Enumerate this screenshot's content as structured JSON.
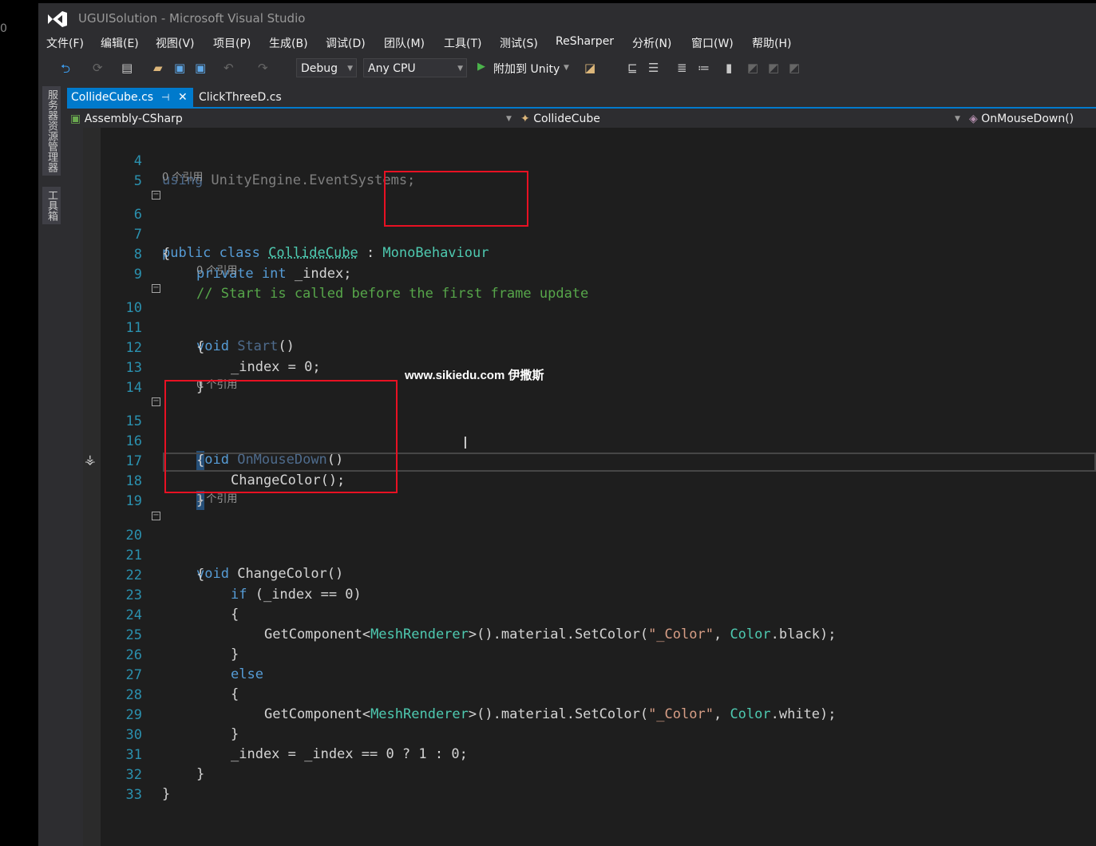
{
  "window": {
    "title": "UGUISolution - Microsoft Visual Studio",
    "left_number": "0"
  },
  "menu": [
    "文件(F)",
    "编辑(E)",
    "视图(V)",
    "项目(P)",
    "生成(B)",
    "调试(D)",
    "团队(M)",
    "工具(T)",
    "测试(S)",
    "ReSharper",
    "分析(N)",
    "窗口(W)",
    "帮助(H)"
  ],
  "toolbar": {
    "configuration": "Debug",
    "platform": "Any CPU",
    "attach_label": "附加到 Unity"
  },
  "side_tabs": [
    "服务器资源管理器",
    "工具箱"
  ],
  "tabs": {
    "active": "CollideCube.cs",
    "second": "ClickThreeD.cs"
  },
  "navbar": {
    "project": "Assembly-CSharp",
    "class": "CollideCube",
    "member": "OnMouseDown()"
  },
  "refs": {
    "zero": "0 个引用",
    "one": "1 个引用"
  },
  "watermark": "www.sikiedu.com 伊撒斯",
  "code": {
    "l4_kw": "using",
    "l4_rest": " UnityEngine.EventSystems;",
    "l6_kw1": "public",
    "l6_kw2": "class",
    "l6_name": "CollideCube",
    "l6_colon": " : ",
    "l6_base": "MonoBehaviour",
    "brace_open": "{",
    "brace_close": "}",
    "l8_kw1": "private",
    "l8_kw2": "int",
    "l8_rest": " _index;",
    "l9": "// Start is called before the first frame update",
    "void": "void",
    "start": "Start",
    "parens": "()",
    "l12": "_index = 0;",
    "onmousedown": "OnMouseDown",
    "l17": "ChangeColor();",
    "changecolor": "ChangeColor",
    "if": "if",
    "l22_rest": " (_index == 0)",
    "getcomponent": "GetComponent<",
    "meshrenderer": "MeshRenderer",
    "l24_mid": ">().material.SetColor(",
    "color_str": "\"_Color\"",
    "comma": ", ",
    "color_type": "Color",
    "black_end": ".black);",
    "white_end": ".white);",
    "else": "else",
    "l30": "_index = _index == 0 ? 1 : 0;"
  }
}
